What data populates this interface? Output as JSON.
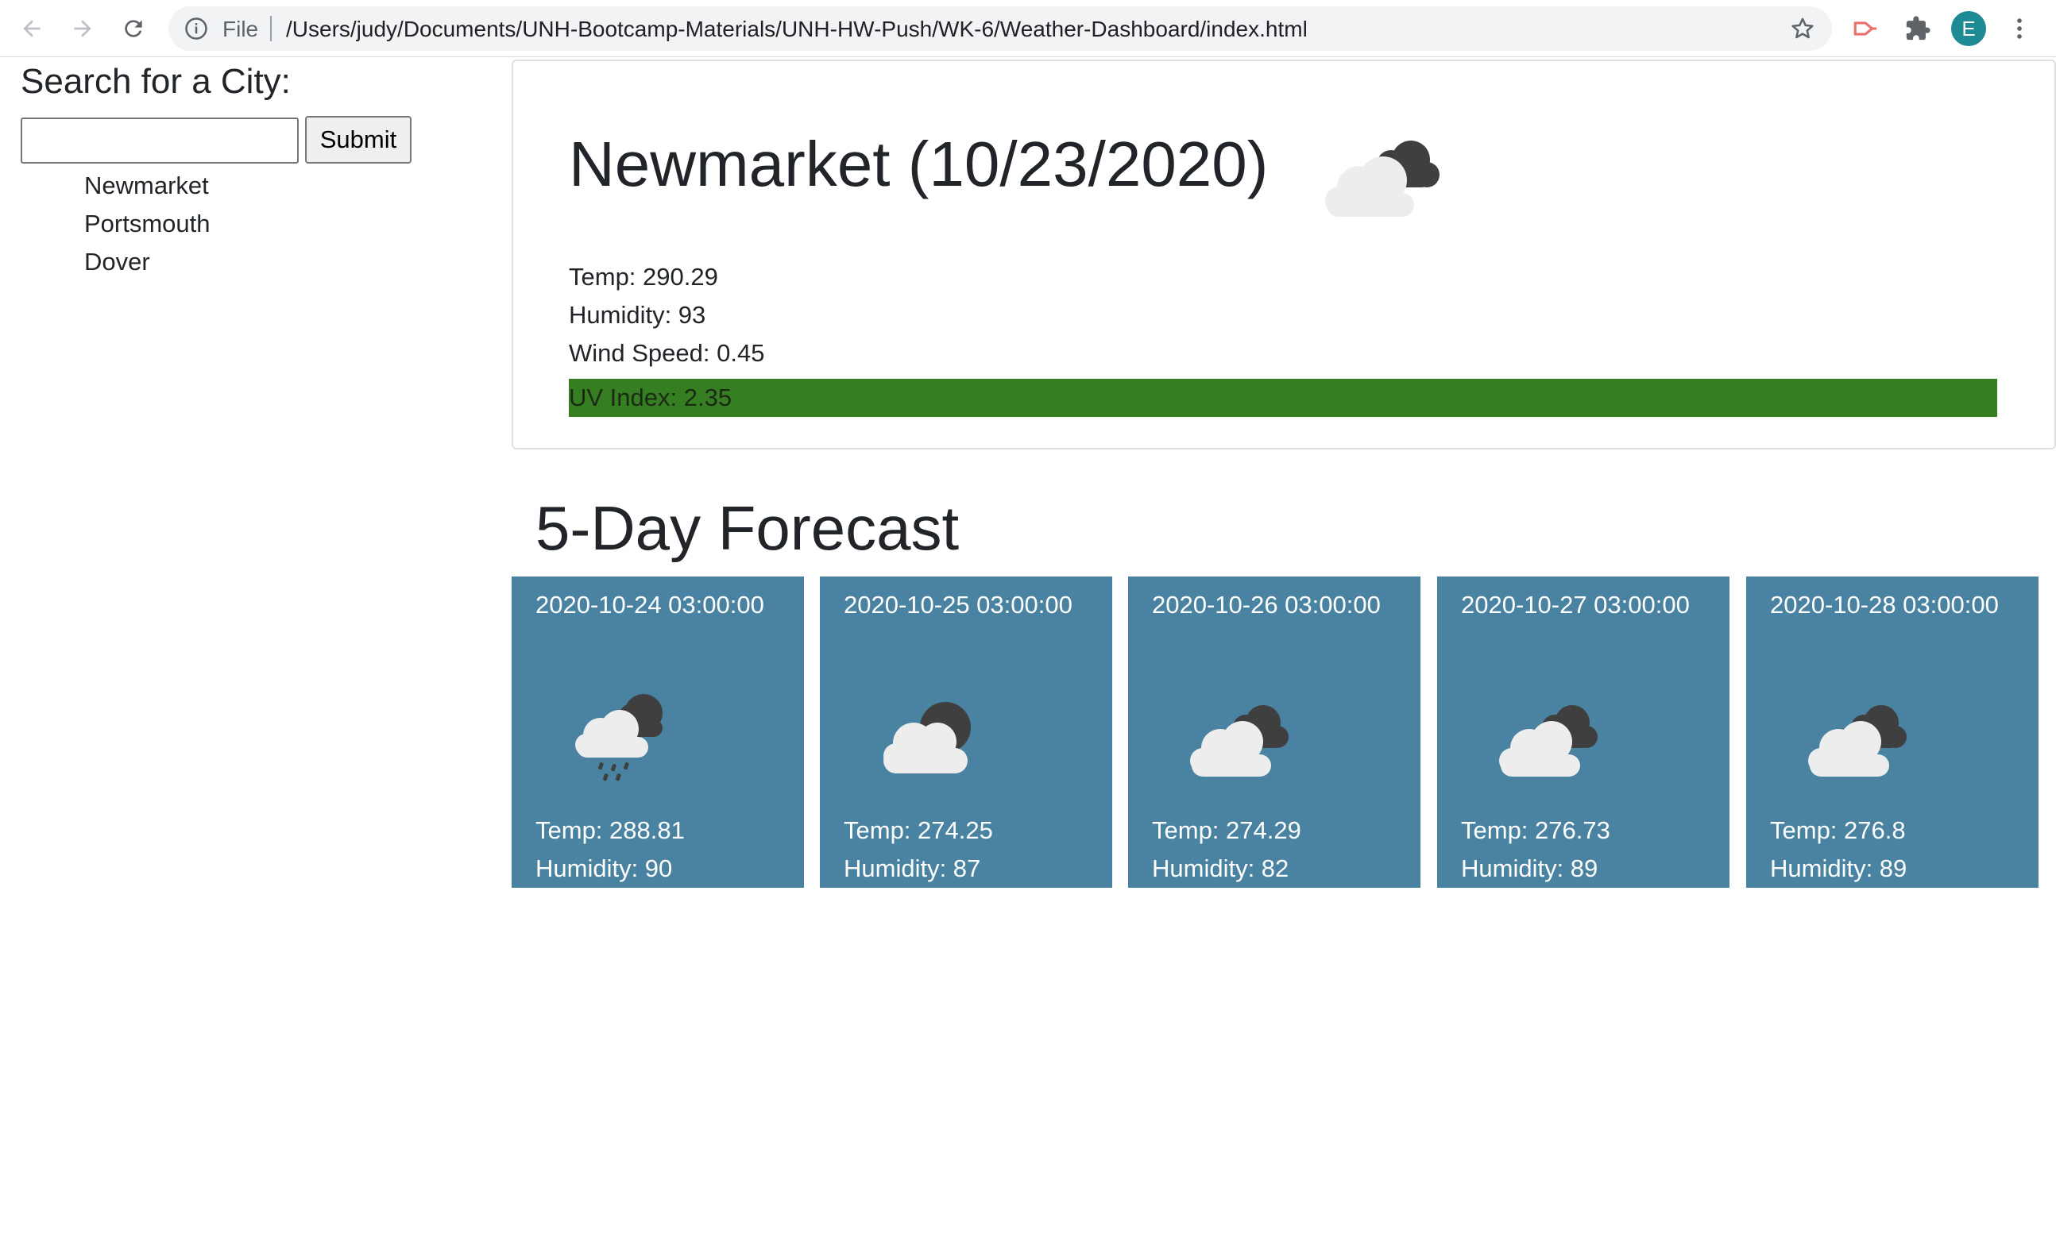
{
  "browser": {
    "url_scheme": "File",
    "url": "/Users/judy/Documents/UNH-Bootcamp-Materials/UNH-HW-Push/WK-6/Weather-Dashboard/index.html",
    "profile_initial": "E"
  },
  "search": {
    "title": "Search for a City:",
    "input_value": "",
    "submit_label": "Submit",
    "history": [
      "Newmarket",
      "Portsmouth",
      "Dover"
    ]
  },
  "current": {
    "title": "Newmarket (10/23/2020)",
    "icon": "cloudy-night-icon",
    "temp": "Temp: 290.29",
    "humidity": "Humidity: 93",
    "wind": "Wind Speed: 0.45",
    "uv": "UV Index: 2.35",
    "uv_value": 2.35,
    "uv_color": "#367e22"
  },
  "forecast": {
    "title": "5-Day Forecast",
    "card_color": "#4a83a2",
    "days": [
      {
        "date": "2020-10-24 03:00:00",
        "icon": "rain-night-icon",
        "temp": "Temp: 288.81",
        "humidity": "Humidity: 90"
      },
      {
        "date": "2020-10-25 03:00:00",
        "icon": "partly-cloudy-night-icon",
        "temp": "Temp: 274.25",
        "humidity": "Humidity: 87"
      },
      {
        "date": "2020-10-26 03:00:00",
        "icon": "cloudy-night-icon",
        "temp": "Temp: 274.29",
        "humidity": "Humidity: 82"
      },
      {
        "date": "2020-10-27 03:00:00",
        "icon": "cloudy-night-icon",
        "temp": "Temp: 276.73",
        "humidity": "Humidity: 89"
      },
      {
        "date": "2020-10-28 03:00:00",
        "icon": "cloudy-night-icon",
        "temp": "Temp: 276.8",
        "humidity": "Humidity: 89"
      }
    ]
  }
}
